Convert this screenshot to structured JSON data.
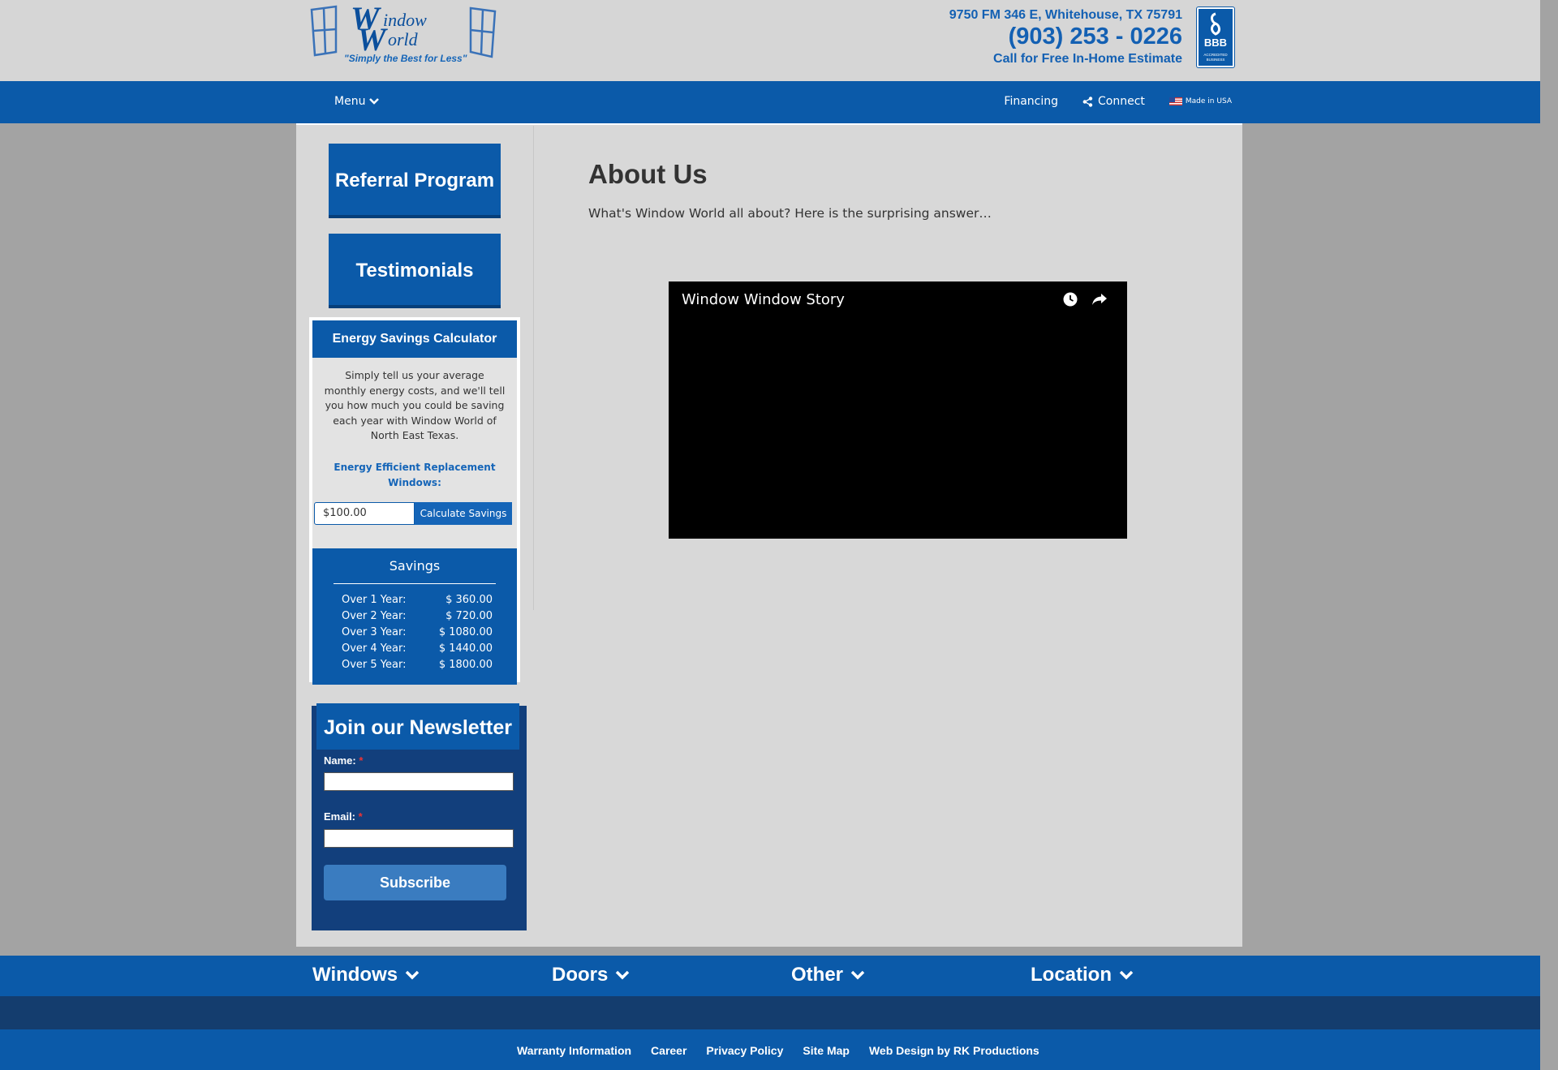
{
  "header": {
    "logo_wordmark": "Window World",
    "logo_tagline": "\"Simply the Best for Less\"",
    "address": "9750 FM 346 E, Whitehouse, TX 75791",
    "phone": "(903) 253 - 0226",
    "cta": "Call for Free In-Home Estimate",
    "bbb_label": "BBB",
    "bbb_sub": "ACCREDITED BUSINESS"
  },
  "nav": {
    "menu_label": "Menu",
    "financing": "Financing",
    "connect": "Connect",
    "made_in_usa": "Made in USA"
  },
  "sidebar": {
    "referral": "Referral Program",
    "testimonials": "Testimonials"
  },
  "calculator": {
    "title": "Energy Savings Calculator",
    "description": "Simply tell us your average monthly energy costs, and we'll tell you how much you could be saving each year with Window World of North East Texas.",
    "subtitle": "Energy Efficient Replacement Windows:",
    "input_value": "$100.00",
    "button": "Calculate Savings",
    "savings_title": "Savings",
    "rows": [
      {
        "label": "Over 1 Year:",
        "value": "$ 360.00"
      },
      {
        "label": "Over 2 Year:",
        "value": "$ 720.00"
      },
      {
        "label": "Over 3 Year:",
        "value": "$ 1080.00"
      },
      {
        "label": "Over 4 Year:",
        "value": "$ 1440.00"
      },
      {
        "label": "Over 5 Year:",
        "value": "$ 1800.00"
      }
    ]
  },
  "newsletter": {
    "title": "Join our Newsletter",
    "name_label": "Name:",
    "email_label": "Email:",
    "required_mark": "*",
    "subscribe": "Subscribe"
  },
  "main": {
    "title": "About Us",
    "intro": "What's Window World all about? Here is the surprising answer…",
    "video_title": "Window Window Story"
  },
  "footer": {
    "categories": [
      "Windows",
      "Doors",
      "Other",
      "Location"
    ],
    "links": [
      "Warranty Information",
      "Career",
      "Privacy Policy",
      "Site Map",
      "Web Design by RK Productions"
    ]
  },
  "colors": {
    "brand_blue": "#0b5aa9",
    "dark_blue": "#123f7c",
    "page_gray": "#a3a3a3",
    "content_gray": "#d8d8d8"
  }
}
